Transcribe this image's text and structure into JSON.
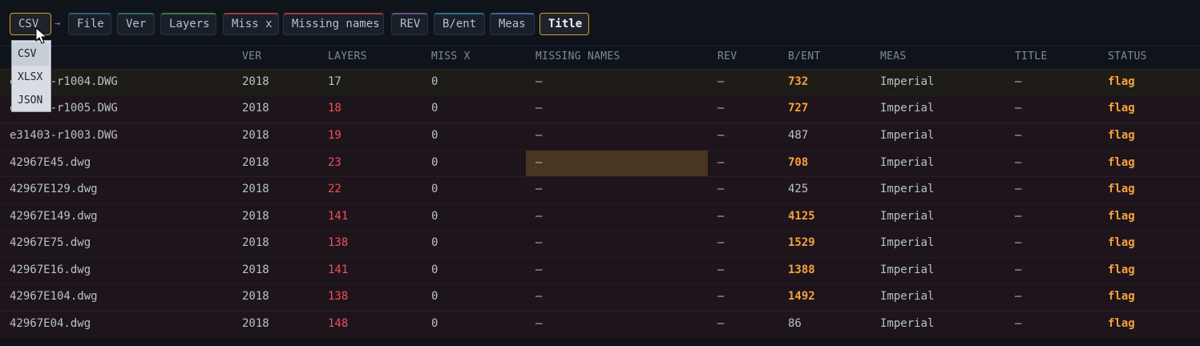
{
  "toolbar": {
    "export_selected": "CSV",
    "arrow": "→",
    "chips": [
      {
        "label": "File",
        "accent": "#2f5d76"
      },
      {
        "label": "Ver",
        "accent": "#2e6a62"
      },
      {
        "label": "Layers",
        "accent": "#3f7a3f"
      },
      {
        "label": "Miss x",
        "accent": "#9a3a44"
      },
      {
        "label": "Missing names",
        "accent": "#9a3a44"
      },
      {
        "label": "REV",
        "accent": "#6a4d8a"
      },
      {
        "label": "B/ent",
        "accent": "#2c6f86"
      },
      {
        "label": "Meas",
        "accent": "#4d5f9a"
      },
      {
        "label": "Title",
        "accent": "#d79a3a"
      }
    ]
  },
  "export_dropdown": {
    "options": [
      "CSV",
      "XLSX",
      "JSON"
    ],
    "hovered_index": 0
  },
  "table": {
    "columns": [
      "VER",
      "LAYERS",
      "MISS X",
      "MISSING NAMES",
      "REV",
      "B/ENT",
      "MEAS",
      "TITLE",
      "STATUS"
    ],
    "rows": [
      {
        "file": "e31403-r1004.DWG",
        "ver": "2018",
        "layers": "17",
        "layers_red": false,
        "miss_x": "0",
        "missing_names": "—",
        "rev": "—",
        "bent": "732",
        "bent_warn": true,
        "meas": "Imperial",
        "title": "—",
        "status": "flag"
      },
      {
        "file": "e31403-r1005.DWG",
        "ver": "2018",
        "layers": "18",
        "layers_red": true,
        "miss_x": "0",
        "missing_names": "—",
        "rev": "—",
        "bent": "727",
        "bent_warn": true,
        "meas": "Imperial",
        "title": "—",
        "status": "flag"
      },
      {
        "file": "e31403-r1003.DWG",
        "ver": "2018",
        "layers": "19",
        "layers_red": true,
        "miss_x": "0",
        "missing_names": "—",
        "rev": "—",
        "bent": "487",
        "bent_warn": false,
        "meas": "Imperial",
        "title": "—",
        "status": "flag"
      },
      {
        "file": "42967E45.dwg",
        "ver": "2018",
        "layers": "23",
        "layers_red": true,
        "miss_x": "0",
        "missing_names": "—",
        "rev": "—",
        "bent": "708",
        "bent_warn": true,
        "meas": "Imperial",
        "title": "—",
        "status": "flag"
      },
      {
        "file": "42967E129.dwg",
        "ver": "2018",
        "layers": "22",
        "layers_red": true,
        "miss_x": "0",
        "missing_names": "—",
        "rev": "—",
        "bent": "425",
        "bent_warn": false,
        "meas": "Imperial",
        "title": "—",
        "status": "flag"
      },
      {
        "file": "42967E149.dwg",
        "ver": "2018",
        "layers": "141",
        "layers_red": true,
        "miss_x": "0",
        "missing_names": "—",
        "rev": "—",
        "bent": "4125",
        "bent_warn": true,
        "meas": "Imperial",
        "title": "—",
        "status": "flag"
      },
      {
        "file": "42967E75.dwg",
        "ver": "2018",
        "layers": "138",
        "layers_red": true,
        "miss_x": "0",
        "missing_names": "—",
        "rev": "—",
        "bent": "1529",
        "bent_warn": true,
        "meas": "Imperial",
        "title": "—",
        "status": "flag"
      },
      {
        "file": "42967E16.dwg",
        "ver": "2018",
        "layers": "141",
        "layers_red": true,
        "miss_x": "0",
        "missing_names": "—",
        "rev": "—",
        "bent": "1388",
        "bent_warn": true,
        "meas": "Imperial",
        "title": "—",
        "status": "flag"
      },
      {
        "file": "42967E104.dwg",
        "ver": "2018",
        "layers": "138",
        "layers_red": true,
        "miss_x": "0",
        "missing_names": "—",
        "rev": "—",
        "bent": "1492",
        "bent_warn": true,
        "meas": "Imperial",
        "title": "—",
        "status": "flag"
      },
      {
        "file": "42967E04.dwg",
        "ver": "2018",
        "layers": "148",
        "layers_red": true,
        "miss_x": "0",
        "missing_names": "—",
        "rev": "—",
        "bent": "86",
        "bent_warn": false,
        "meas": "Imperial",
        "title": "—",
        "status": "flag"
      }
    ]
  },
  "colors": {
    "row_bg": "#1e141c",
    "row_bg_first": "#1e1c17",
    "warn": "#f6a23c",
    "error": "#f0505c",
    "highlight_cell": "#4a3522"
  }
}
